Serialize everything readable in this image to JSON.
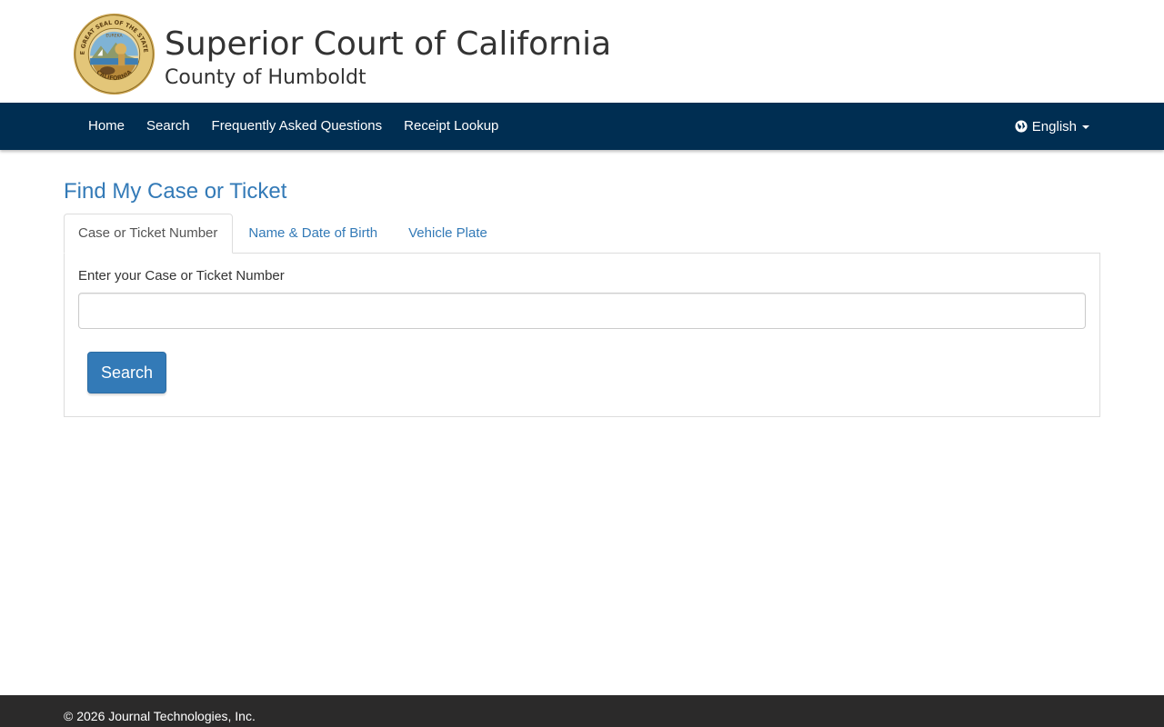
{
  "header": {
    "title": "Superior Court of California",
    "subtitle": "County of Humboldt",
    "seal": {
      "icon": "state-seal-icon",
      "top_text": "THE GREAT SEAL OF THE STATE OF",
      "bottom_text": "CALIFORNIA",
      "motto": "EUREKA",
      "colors": {
        "ring": "#c9a24e",
        "inner": "#e8d7a7",
        "sky": "#7fb3d5"
      }
    }
  },
  "nav": {
    "items": [
      {
        "label": "Home"
      },
      {
        "label": "Search"
      },
      {
        "label": "Frequently Asked Questions"
      },
      {
        "label": "Receipt Lookup"
      }
    ],
    "language": {
      "label": "English",
      "icon": "globe-icon"
    },
    "color": "#002e52"
  },
  "main": {
    "page_title": "Find My Case or Ticket",
    "tabs": [
      {
        "label": "Case or Ticket Number",
        "active": true
      },
      {
        "label": "Name & Date of Birth",
        "active": false
      },
      {
        "label": "Vehicle Plate",
        "active": false
      }
    ],
    "form": {
      "field_label": "Enter your Case or Ticket Number",
      "field_value": "",
      "search_label": "Search"
    }
  },
  "footer": {
    "text": "© 2026 Journal Technologies, Inc."
  },
  "colors": {
    "link": "#337ab7",
    "button": "#337ab7",
    "footer": "#2b2a2a"
  }
}
